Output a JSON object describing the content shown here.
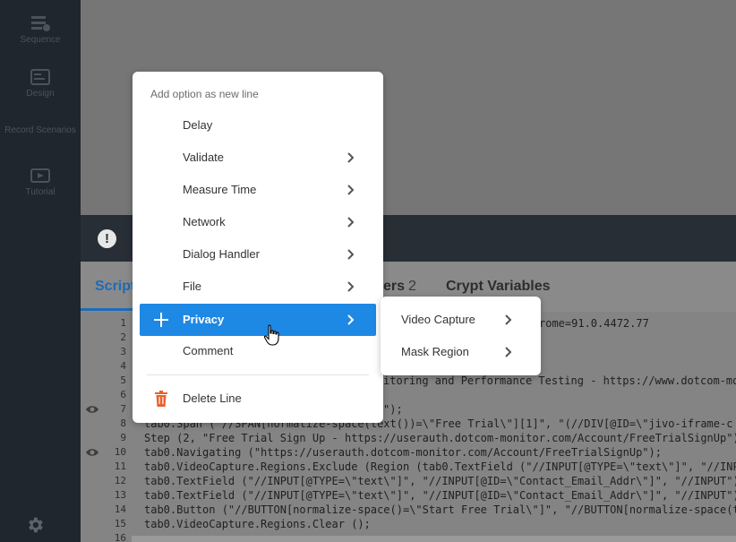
{
  "sidebar": {
    "items": [
      {
        "label": "Sequence",
        "icon": "sequence-icon"
      },
      {
        "label": "Design",
        "icon": "design-icon"
      },
      {
        "label": "Record Scenarios",
        "icon": "record-icon"
      },
      {
        "label": "Tutorial",
        "icon": "tutorial-icon"
      }
    ],
    "settings_icon": "gear-icon"
  },
  "tabs": {
    "script": "Script",
    "users": "ers",
    "users_count": "2",
    "crypt": "Crypt Variables"
  },
  "menu": {
    "header": "Add option as new line",
    "items": [
      {
        "label": "Delay",
        "has_submenu": false
      },
      {
        "label": "Validate",
        "has_submenu": true
      },
      {
        "label": "Measure Time",
        "has_submenu": true
      },
      {
        "label": "Network",
        "has_submenu": true
      },
      {
        "label": "Dialog Handler",
        "has_submenu": true
      },
      {
        "label": "File",
        "has_submenu": true
      },
      {
        "label": "Privacy",
        "has_submenu": true
      },
      {
        "label": "Comment",
        "has_submenu": false
      },
      {
        "label": "Delete Line",
        "has_submenu": false
      }
    ]
  },
  "submenu": {
    "items": [
      {
        "label": "Video Capture"
      },
      {
        "label": "Mask Region"
      }
    ]
  },
  "code": {
    "lines": [
      {
        "n": "1",
        "text": "rome=91.0.4472.77"
      },
      {
        "n": "2",
        "text": ""
      },
      {
        "n": "3",
        "text": ""
      },
      {
        "n": "4",
        "text": ""
      },
      {
        "n": "5",
        "text": "itoring and Performance Testing - https://www.dotcom-mon"
      },
      {
        "n": "6",
        "text": ""
      },
      {
        "n": "7",
        "text": "\");"
      },
      {
        "n": "8",
        "text": "tab0.Span (\"//SPAN[normalize-space(text())=\\\"Free Trial\\\"][1]\", \"(//DIV[@ID=\\\"jivo-iframe-c"
      },
      {
        "n": "9",
        "text": "Step (2, \"Free Trial Sign Up - https://userauth.dotcom-monitor.com/Account/FreeTrialSignUp\");"
      },
      {
        "n": "10",
        "text": "tab0.Navigating (\"https://userauth.dotcom-monitor.com/Account/FreeTrialSignUp\");"
      },
      {
        "n": "11",
        "text": "tab0.VideoCapture.Regions.Exclude (Region (tab0.TextField (\"//INPUT[@TYPE=\\\"text\\\"]\", \"//INPU"
      },
      {
        "n": "12",
        "text": "tab0.TextField (\"//INPUT[@TYPE=\\\"text\\\"]\", \"//INPUT[@ID=\\\"Contact_Email_Addr\\\"]\", \"//INPUT\")."
      },
      {
        "n": "13",
        "text": "tab0.TextField (\"//INPUT[@TYPE=\\\"text\\\"]\", \"//INPUT[@ID=\\\"Contact_Email_Addr\\\"]\", \"//INPUT\")."
      },
      {
        "n": "14",
        "text": "tab0.Button (\"//BUTTON[normalize-space()=\\\"Start Free Trial\\\"]\", \"//BUTTON[normalize-space(te"
      },
      {
        "n": "15",
        "text": "tab0.VideoCapture.Regions.Clear ();"
      },
      {
        "n": "16",
        "text": ""
      }
    ]
  },
  "colors": {
    "accent": "#1e88e5",
    "delete": "#e8612c",
    "sidebar": "#1f262d"
  }
}
